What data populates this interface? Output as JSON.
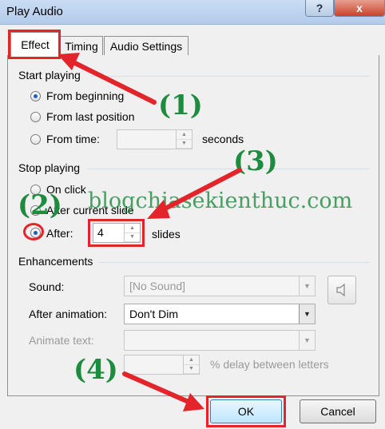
{
  "window": {
    "title": "Play Audio",
    "help_label": "?",
    "close_label": "x"
  },
  "tabs": [
    {
      "label": "Effect"
    },
    {
      "label": "Timing"
    },
    {
      "label": "Audio Settings"
    }
  ],
  "start_playing": {
    "label": "Start playing",
    "options": [
      {
        "label": "From beginning",
        "selected": true
      },
      {
        "label": "From last position",
        "selected": false
      },
      {
        "label": "From time:",
        "selected": false
      }
    ],
    "time_value": "",
    "seconds_label": "seconds"
  },
  "stop_playing": {
    "label": "Stop playing",
    "options": [
      {
        "label": "On click",
        "selected": false
      },
      {
        "label": "After current slide",
        "selected": false
      },
      {
        "label": "After:",
        "selected": true
      }
    ],
    "after_value": "4",
    "slides_label": "slides"
  },
  "enhancements": {
    "label": "Enhancements",
    "sound_label": "Sound:",
    "sound_value": "[No Sound]",
    "after_animation_label": "After animation:",
    "after_animation_value": "Don't Dim",
    "animate_text_label": "Animate text:",
    "animate_text_value": "",
    "delay_value": "",
    "delay_label": "% delay between letters"
  },
  "buttons": {
    "ok": "OK",
    "cancel": "Cancel"
  },
  "annotations": {
    "a1": "(1)",
    "a2": "(2)",
    "a3": "(3)",
    "a4": "(4)",
    "watermark": "blogchiasekienthuc.com"
  },
  "colors": {
    "highlight": "#e3242b",
    "annotation": "#1e8c3e",
    "radio_selected": "#1e5fbd"
  },
  "icons": {
    "speaker": "speaker-icon",
    "spin": "spin-arrows-icon",
    "dropdown": "dropdown-arrow-icon"
  }
}
